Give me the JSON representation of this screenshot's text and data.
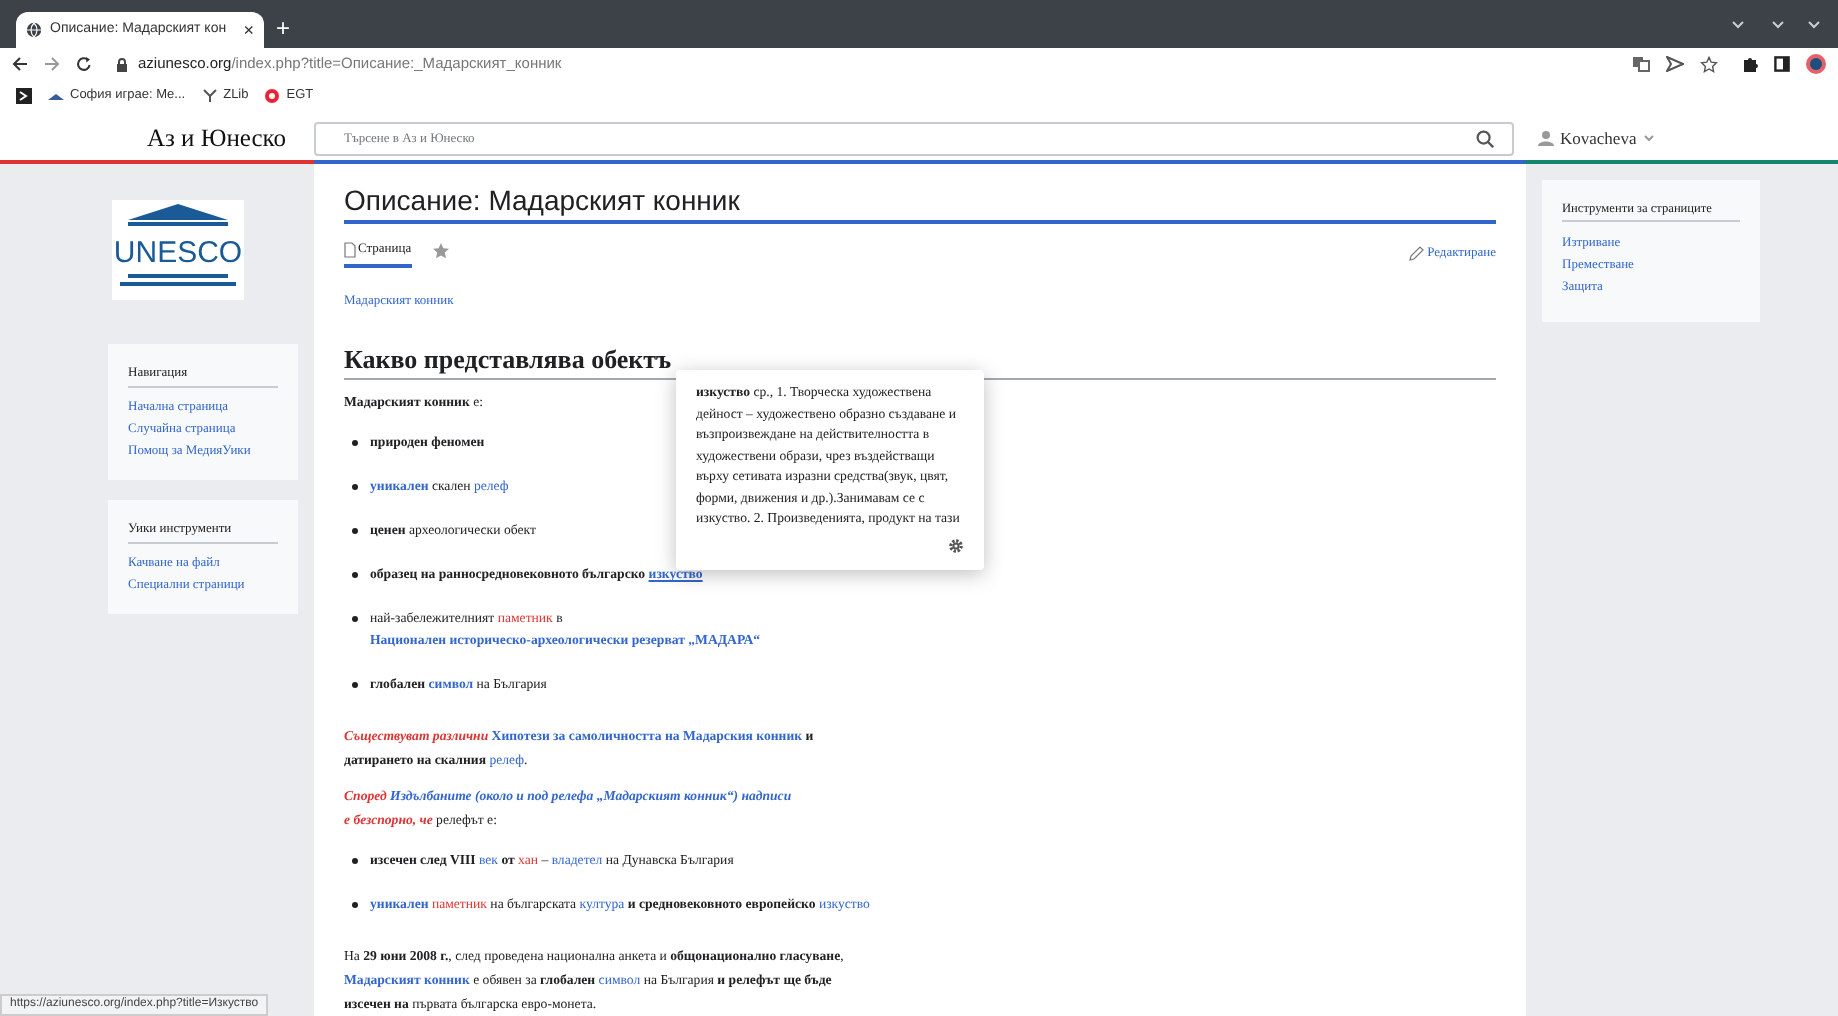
{
  "browser": {
    "tab_title": "Описание: Мадарският кон",
    "tab_close": "×",
    "new_tab": "+",
    "url_host": "aziunesco.org",
    "url_path": "/index.php?title=Описание:_Мадарският_конник",
    "bookmarks": [
      "София играе: Ме...",
      "ZLib",
      "EGT"
    ]
  },
  "site": {
    "logo_text": "Аз и Юнеско",
    "search": {
      "placeholder": "Търсене в Аз и Юнеско"
    },
    "user": "Kovacheva"
  },
  "left_sidebar": {
    "logo_text": "UNESCO",
    "sections": [
      {
        "title": "Навигация",
        "items": [
          "Начална страница",
          "Случайна страница",
          "Помощ за МедияУики"
        ]
      },
      {
        "title": "Уики инструменти",
        "items": [
          "Качване на файл",
          "Специални страници"
        ]
      }
    ]
  },
  "right_sidebar": {
    "title": "Инструменти за страниците",
    "items": [
      "Изтриване",
      "Преместване",
      "Защита"
    ]
  },
  "page": {
    "title": "Описание: Мадарският конник",
    "tabs": [
      {
        "label": "Страница",
        "selected": true
      }
    ],
    "edit": "Редактиране",
    "breadcrumb": "Мадарският конник",
    "heading": "Какво представлява обектъ",
    "blocks": [
      {
        "kind": "paragraph",
        "segments": [
          {
            "kind": "bold",
            "text": "Мадарският конник"
          },
          {
            "kind": "plain",
            "text": " е:"
          }
        ]
      },
      {
        "kind": "bullet",
        "segments": [
          {
            "kind": "bold",
            "text": "природен феномен"
          }
        ]
      },
      {
        "kind": "bullet",
        "segments": [
          {
            "kind": "boldlink",
            "text": "уникален"
          },
          {
            "kind": "plain",
            "text": " скален "
          },
          {
            "kind": "link",
            "text": "релеф"
          }
        ]
      },
      {
        "kind": "bullet",
        "segments": [
          {
            "kind": "bold",
            "text": "ценен"
          },
          {
            "kind": "plain",
            "text": " археологически обект"
          }
        ]
      },
      {
        "kind": "bullet",
        "segments": [
          {
            "kind": "bold",
            "text": "образец на ранносредновековното българско "
          },
          {
            "kind": "hoverlink",
            "text": "изкуство"
          }
        ]
      },
      {
        "kind": "bullet",
        "segments": [
          {
            "kind": "plain",
            "text": "най-забележителният "
          },
          {
            "kind": "redlink",
            "text": "паметник"
          },
          {
            "kind": "plain",
            "text": " в"
          },
          {
            "kind": "break"
          },
          {
            "kind": "boldlink",
            "text": "Национален историческо-археологически резерват „МАДАРА“"
          }
        ]
      },
      {
        "kind": "bullet",
        "segments": [
          {
            "kind": "bold",
            "text": "глобален "
          },
          {
            "kind": "boldlink",
            "text": "символ"
          },
          {
            "kind": "plain",
            "text": " на България"
          }
        ]
      },
      {
        "kind": "paragraph",
        "segments": [
          {
            "kind": "redemph",
            "text": "Съществуват различни"
          },
          {
            "kind": "boldlink",
            "text": " Хипотези за самоличността на Мадарския конник"
          },
          {
            "kind": "bold",
            "text": " и"
          },
          {
            "kind": "break"
          },
          {
            "kind": "bold",
            "text": "датирането на скалния "
          },
          {
            "kind": "link",
            "text": "релеф"
          },
          {
            "kind": "plain",
            "text": "."
          }
        ]
      },
      {
        "kind": "paragraph",
        "segments": [
          {
            "kind": "redemph",
            "text": "Според"
          },
          {
            "kind": "italiclink",
            "text": " Издълбаните (около и под релефа „Мадарският конник“) надписи"
          },
          {
            "kind": "break"
          },
          {
            "kind": "redemph",
            "text": "е безспорно, че"
          },
          {
            "kind": "plain",
            "text": " релефът е:"
          }
        ]
      },
      {
        "kind": "bullet",
        "segments": [
          {
            "kind": "bold",
            "text": "изсечен след VIII "
          },
          {
            "kind": "link",
            "text": "век"
          },
          {
            "kind": "bold",
            "text": " от "
          },
          {
            "kind": "redlink",
            "text": "хан"
          },
          {
            "kind": "plain",
            "text": " – "
          },
          {
            "kind": "link",
            "text": "владетел"
          },
          {
            "kind": "plain",
            "text": " на Дунавска България"
          }
        ]
      },
      {
        "kind": "bullet",
        "segments": [
          {
            "kind": "boldlink",
            "text": "уникален "
          },
          {
            "kind": "redlink",
            "text": "паметник"
          },
          {
            "kind": "plain",
            "text": " на българската "
          },
          {
            "kind": "link",
            "text": "култура"
          },
          {
            "kind": "bold",
            "text": " и средновековното европейско "
          },
          {
            "kind": "link",
            "text": "изкуство"
          }
        ]
      },
      {
        "kind": "paragraph",
        "segments": [
          {
            "kind": "plain",
            "text": "На "
          },
          {
            "kind": "bold",
            "text": "29 юни 2008 г."
          },
          {
            "kind": "plain",
            "text": ", след проведена национална анкета и "
          },
          {
            "kind": "bold",
            "text": "общонационално гласуване"
          },
          {
            "kind": "plain",
            "text": ","
          },
          {
            "kind": "break"
          },
          {
            "kind": "boldlink",
            "text": "Мадарският конник"
          },
          {
            "kind": "plain",
            "text": " е обявен за "
          },
          {
            "kind": "bold",
            "text": "глобален"
          },
          {
            "kind": "link",
            "text": " символ"
          },
          {
            "kind": "plain",
            "text": " на България"
          },
          {
            "kind": "bold",
            "text": " и релефът ще бъде"
          },
          {
            "kind": "break"
          },
          {
            "kind": "bold",
            "text": "изсечен на"
          },
          {
            "kind": "plain",
            "text": " първата българска евро-монета."
          }
        ]
      }
    ]
  },
  "tooltip": {
    "text": "**изкуство** ср., 1. Творческа художествена дейност – художествено образно създаване и възпроизвеждане на действителността в художествени образи, чрез въздействащи върху сетивата изразни средства(звук, цвят, форми, движения и др.).Занимавам се с изкуство. 2. Произведенията, продукт на тази"
  },
  "status_url": "https://aziunesco.org/index.php?title=Изкуство"
}
